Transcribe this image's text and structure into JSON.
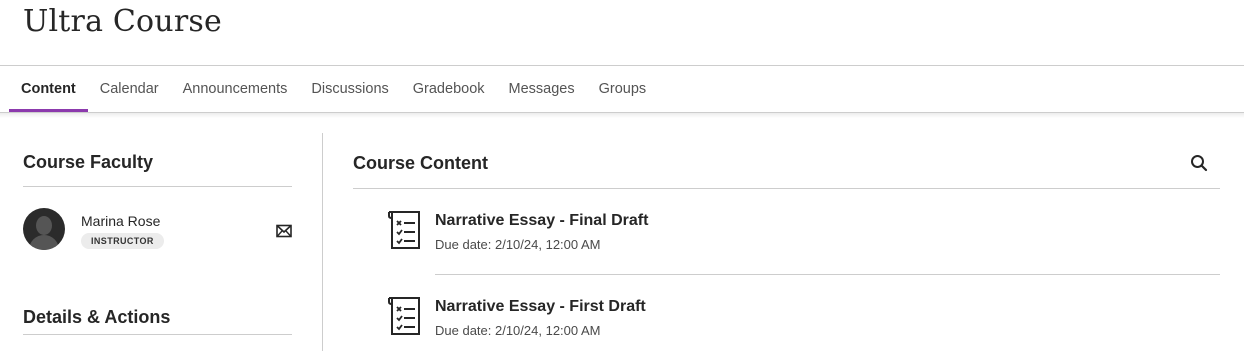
{
  "course": {
    "title": "Ultra Course"
  },
  "tabs": [
    {
      "label": "Content",
      "active": true
    },
    {
      "label": "Calendar",
      "active": false
    },
    {
      "label": "Announcements",
      "active": false
    },
    {
      "label": "Discussions",
      "active": false
    },
    {
      "label": "Gradebook",
      "active": false
    },
    {
      "label": "Messages",
      "active": false
    },
    {
      "label": "Groups",
      "active": false
    }
  ],
  "faculty": {
    "heading": "Course Faculty",
    "members": [
      {
        "name": "Marina Rose",
        "role": "INSTRUCTOR",
        "icon": "mail-icon"
      }
    ]
  },
  "details": {
    "heading": "Details & Actions"
  },
  "content": {
    "heading": "Course Content",
    "search_icon": "search-icon",
    "items": [
      {
        "title": "Narrative Essay - Final Draft",
        "due": "Due date: 2/10/24, 12:00 AM",
        "icon": "assignment-checklist-icon"
      },
      {
        "title": "Narrative Essay - First Draft",
        "due": "Due date: 2/10/24, 12:00 AM",
        "icon": "assignment-checklist-icon"
      }
    ]
  },
  "colors": {
    "accent": "#8c3aad",
    "divider": "#cdcdcd",
    "text": "#262626"
  }
}
